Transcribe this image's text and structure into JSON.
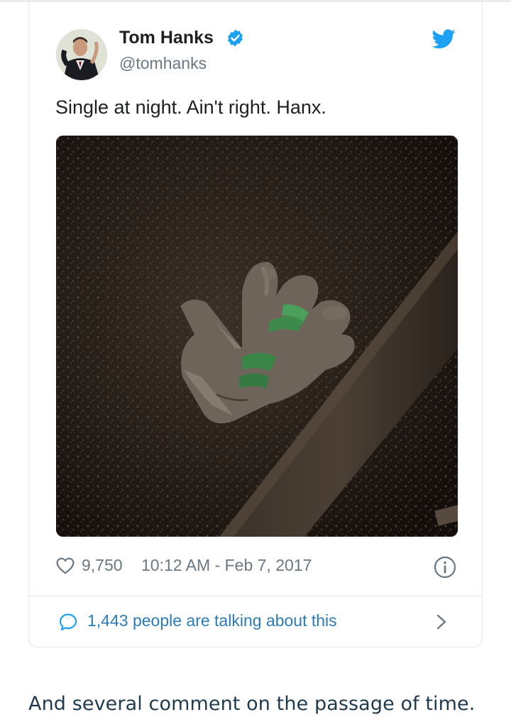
{
  "tweet": {
    "author": {
      "display_name": "Tom Hanks",
      "handle": "@tomhanks",
      "verified": true,
      "avatar_icon": "avatar-photo"
    },
    "brand_icon": "twitter-bird-icon",
    "text": "Single at night. Ain't right. Hanx.",
    "media": {
      "type": "photo",
      "icon": "photo-glove-on-ground"
    },
    "likes": "9,750",
    "timestamp": "10:12 AM - Feb 7, 2017",
    "conversation": {
      "label": "1,443 people are talking about this"
    }
  },
  "caption": "And several comment on the passage of time.",
  "colors": {
    "twitter_blue": "#1da1f2",
    "link_blue": "#2b7bb9",
    "meta_gray": "#697882",
    "text_dark": "#1c2022",
    "border": "#e1e8ed",
    "caption_text": "#1f3a4d"
  }
}
